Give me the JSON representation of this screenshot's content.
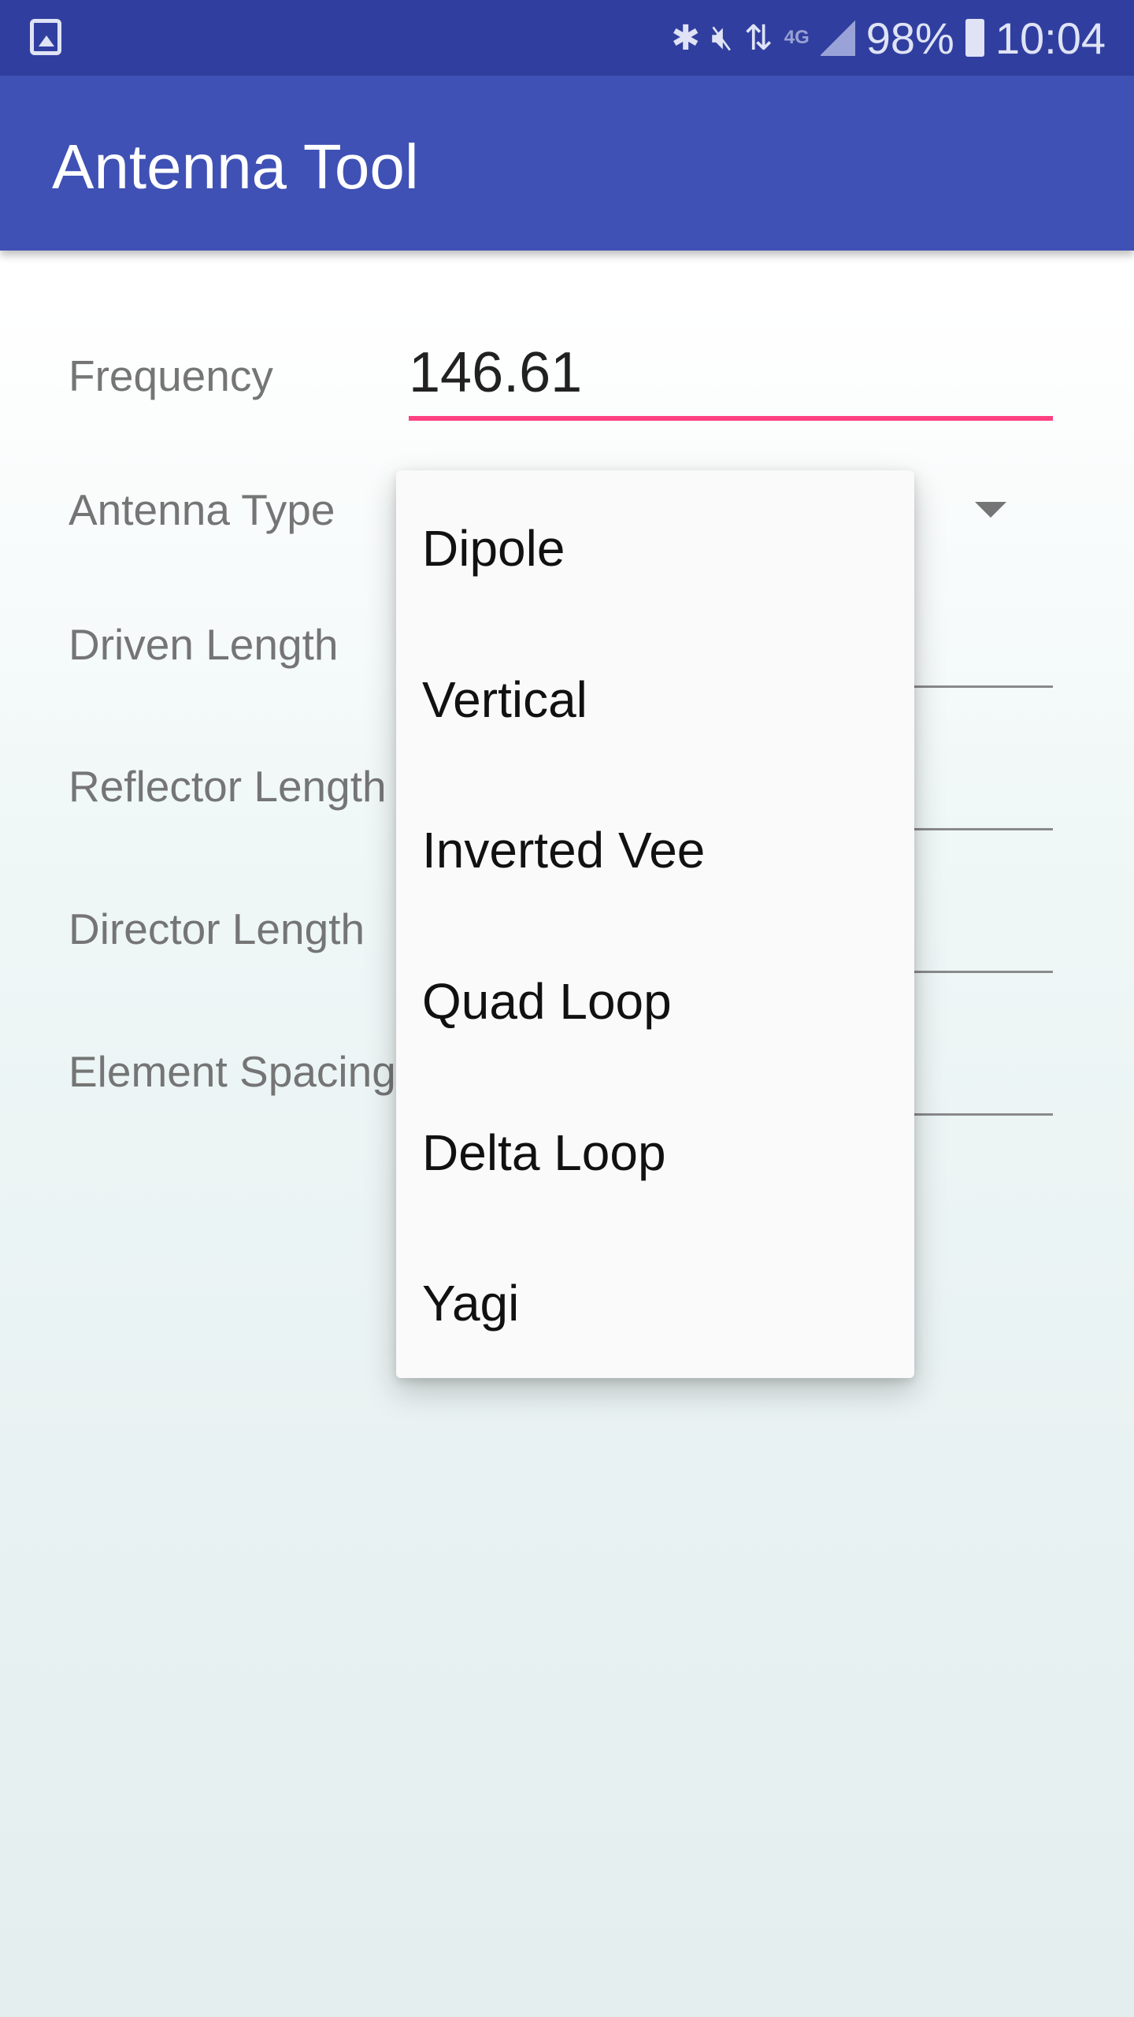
{
  "status_bar": {
    "battery": "98%",
    "time": "10:04",
    "network": "4G",
    "icons": [
      "gallery-icon",
      "bluetooth-icon",
      "mute-icon",
      "wifi-icon",
      "4g-icon",
      "signal-icon",
      "battery-icon"
    ]
  },
  "app_bar": {
    "title": "Antenna Tool",
    "color": "#3f51b5"
  },
  "form": {
    "frequency_label": "Frequency",
    "frequency_value": "146.61",
    "antenna_type_label": "Antenna Type",
    "driven_length_label": "Driven Length",
    "reflector_length_label": "Reflector Length",
    "director_length_label": "Director Length",
    "element_spacing_label": "Element Spacing",
    "accent_color": "#ff4081"
  },
  "dropdown": {
    "options": [
      "Dipole",
      "Vertical",
      "Inverted Vee",
      "Quad Loop",
      "Delta Loop",
      "Yagi"
    ]
  }
}
